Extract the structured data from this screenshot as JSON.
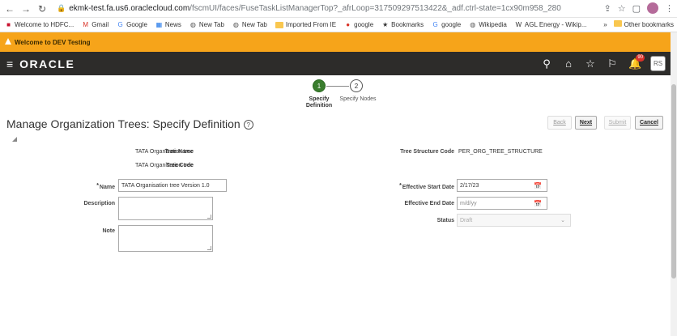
{
  "browser": {
    "url_host": "ekmk-test.fa.us6.oraclecloud.com",
    "url_path": "/fscmUI/faces/FuseTaskListManagerTop?_afrLoop=317509297513422&_adf.ctrl-state=1cx90m958_280",
    "bookmarks": [
      {
        "label": "Welcome to HDFC...",
        "icon": "hdfc-icon",
        "color": "#c8102e"
      },
      {
        "label": "Gmail",
        "icon": "gmail-icon",
        "color": "#d93025"
      },
      {
        "label": "Google",
        "icon": "google-icon",
        "color": "#4285f4"
      },
      {
        "label": "News",
        "icon": "news-icon",
        "color": "#1a73e8"
      },
      {
        "label": "New Tab",
        "icon": "globe-icon",
        "color": "#555"
      },
      {
        "label": "New Tab",
        "icon": "globe-icon",
        "color": "#555"
      },
      {
        "label": "Imported From IE",
        "icon": "folder-icon",
        "color": "#f9c74f"
      },
      {
        "label": "google",
        "icon": "google-red-icon",
        "color": "#d93025"
      },
      {
        "label": "Bookmarks",
        "icon": "star-icon",
        "color": "#333"
      },
      {
        "label": "google",
        "icon": "google-icon",
        "color": "#4285f4"
      },
      {
        "label": "Wikipedia",
        "icon": "globe-icon",
        "color": "#555"
      },
      {
        "label": "AGL Energy - Wikip...",
        "icon": "wikipedia-icon",
        "color": "#333"
      }
    ],
    "more_label": "»",
    "other_bookmarks": "Other bookmarks"
  },
  "banner": {
    "text": "Welcome to DEV Testing"
  },
  "header": {
    "logo": "ORACLE",
    "notification_count": "90",
    "avatar_initials": "RS"
  },
  "train": {
    "steps": [
      {
        "number": "1",
        "label": "Specify Definition"
      },
      {
        "number": "2",
        "label": "Specify Nodes"
      }
    ]
  },
  "page": {
    "title": "Manage Organization Trees: Specify Definition",
    "help_icon": "?"
  },
  "actions": {
    "back": "Back",
    "next": "Next",
    "submit": "Submit",
    "cancel": "Cancel"
  },
  "form": {
    "tree_name_label": "Tree Name",
    "tree_name_value": "TATA Organisation tree",
    "tree_code_label": "Tree Code",
    "tree_code_value": "TATA Organisation tree",
    "tree_structure_code_label": "Tree Structure Code",
    "tree_structure_code_value": "PER_ORG_TREE_STRUCTURE",
    "name_label": "Name",
    "name_value": "TATA Organisation tree Version 1.0",
    "description_label": "Description",
    "note_label": "Note",
    "effective_start_label": "Effective Start Date",
    "effective_start_value": "2/17/23",
    "effective_end_label": "Effective End Date",
    "effective_end_placeholder": "m/d/yy",
    "status_label": "Status",
    "status_value": "Draft",
    "required_mark": "*"
  }
}
